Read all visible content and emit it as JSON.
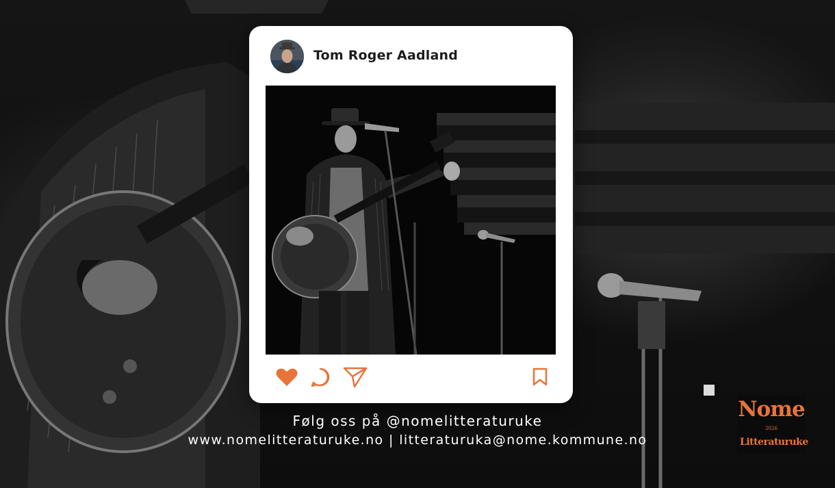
{
  "post": {
    "author_name": "Tom Roger Aadland",
    "actions": {
      "like_icon": "heart-icon",
      "comment_icon": "comment-icon",
      "share_icon": "send-icon",
      "save_icon": "bookmark-icon",
      "accent_color": "#e8743a"
    }
  },
  "footer": {
    "follow_text": "Følg oss på @nomelitteraturuke",
    "website": "www.nomelitteraturuke.no",
    "separator": " | ",
    "email": "litteraturuka@nome.kommune.no"
  },
  "logo": {
    "line1": "Nome",
    "year": "2026",
    "line2": "Litteraturuke",
    "color": "#e8743a"
  }
}
